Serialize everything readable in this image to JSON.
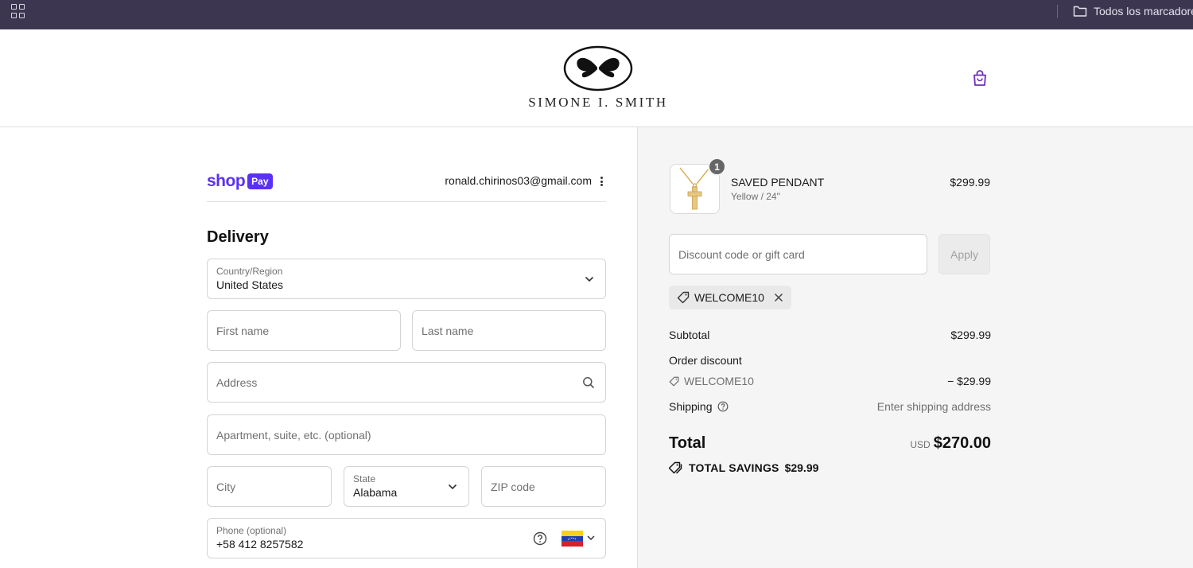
{
  "browser": {
    "bookmarks_folder": "Todos los marcadores"
  },
  "header": {
    "brand": "SIMONE I. SMITH"
  },
  "account": {
    "shop_label": "shop",
    "pay_label": "Pay",
    "email": "ronald.chirinos03@gmail.com"
  },
  "delivery": {
    "title": "Delivery",
    "country_label": "Country/Region",
    "country_value": "United States",
    "first_name_placeholder": "First name",
    "last_name_placeholder": "Last name",
    "address_placeholder": "Address",
    "apartment_placeholder": "Apartment, suite, etc. (optional)",
    "city_placeholder": "City",
    "state_label": "State",
    "state_value": "Alabama",
    "zip_placeholder": "ZIP code",
    "phone_label": "Phone (optional)",
    "phone_value": "+58 412 8257582"
  },
  "summary": {
    "product": {
      "name": "SAVED PENDANT",
      "variant": "Yellow / 24\"",
      "price": "$299.99",
      "quantity": "1"
    },
    "discount_placeholder": "Discount code or gift card",
    "apply_label": "Apply",
    "applied_code": "WELCOME10",
    "subtotal_label": "Subtotal",
    "subtotal_value": "$299.99",
    "order_discount_label": "Order discount",
    "discount_code": "WELCOME10",
    "discount_value": "− $29.99",
    "shipping_label": "Shipping",
    "shipping_value": "Enter shipping address",
    "total_label": "Total",
    "total_currency": "USD",
    "total_value": "$270.00",
    "savings_label": "TOTAL SAVINGS",
    "savings_value": "$29.99"
  }
}
